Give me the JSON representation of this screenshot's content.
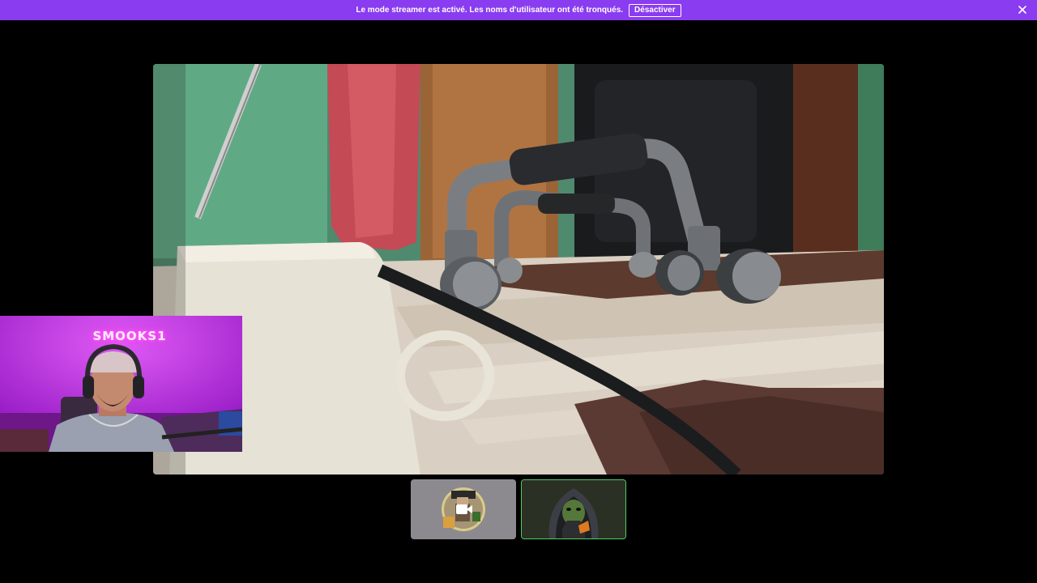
{
  "notice_bar": {
    "message": "Le mode streamer est activé. Les noms d'utilisateur ont été tronqués.",
    "disable_button": "Désactiver",
    "close_icon": "close-icon",
    "background_color": "#8a3cf0"
  },
  "self_camera": {
    "neon_sign_text": "SMOOKS1",
    "glow_color": "#ff3cf0"
  },
  "main_video": {
    "content": "video-feed"
  },
  "participants": {
    "tile_1": {
      "icon": "video-camera-icon",
      "avatar": "pixel-avatar"
    },
    "tile_2": {
      "avatar": "hooded-avatar",
      "active_border_color": "#4fcf5e"
    }
  }
}
